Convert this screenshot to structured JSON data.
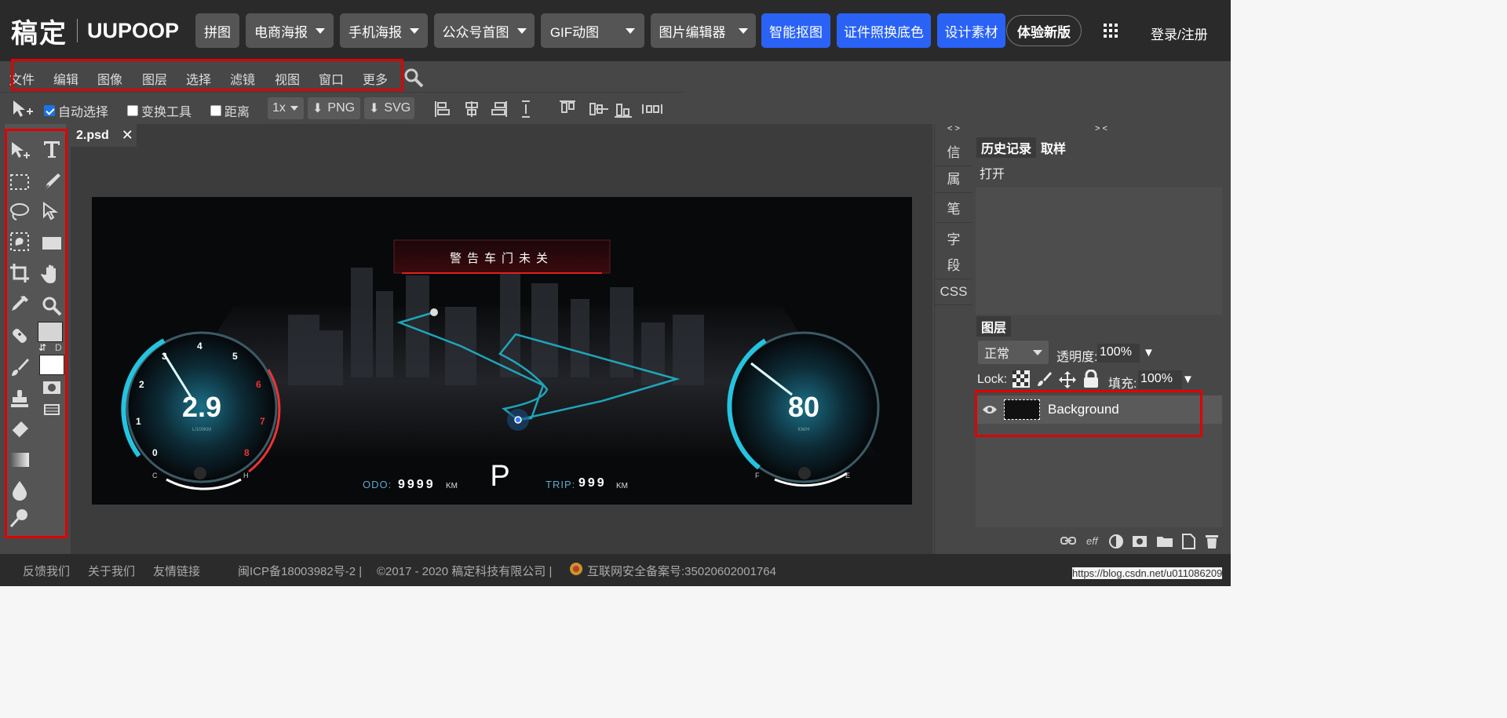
{
  "brand": {
    "cn": "稿定",
    "en": "UUPOOP"
  },
  "topnav": {
    "items": [
      "拼图",
      "电商海报",
      "手机海报",
      "公众号首图",
      "GIF动图",
      "图片编辑器"
    ],
    "blue_items": [
      "智能抠图",
      "证件照换底色",
      "设计素材"
    ],
    "new_version": "体验新版",
    "login": "登录/注册"
  },
  "menu": {
    "items": [
      "文件",
      "编辑",
      "图像",
      "图层",
      "选择",
      "滤镜",
      "视图",
      "窗口",
      "更多"
    ]
  },
  "options": {
    "auto_select": "自动选择",
    "auto_select_checked": true,
    "transform": "变换工具",
    "transform_checked": false,
    "distance": "距离",
    "distance_checked": false,
    "scale": "1x",
    "png": "PNG",
    "svg": "SVG"
  },
  "panel_toggle": {
    "left": "> <",
    "sidestrip": "< >",
    "right": "> <"
  },
  "document": {
    "tab": "2.psd"
  },
  "swatch_label": "D",
  "dashboard": {
    "warning": "警告车门未关",
    "fuel_value": "2.9",
    "fuel_unit": "L/100KM",
    "fuel_ticks": [
      "0",
      "1",
      "2",
      "3",
      "4",
      "5",
      "6",
      "7",
      "8"
    ],
    "fuel_cold": "C",
    "fuel_hot": "H",
    "speed_value": "80",
    "speed_unit": "KM/H",
    "speed_f": "F",
    "speed_e": "E",
    "odo_label": "ODO:",
    "odo_value": "9999",
    "odo_unit": "KM",
    "gear": "P",
    "trip_label": "TRIP:",
    "trip_value": "999",
    "trip_unit": "KM"
  },
  "sidestrip": {
    "items": [
      "信",
      "属",
      "笔",
      "字",
      "段",
      "CSS"
    ]
  },
  "history": {
    "tabs": [
      "历史记录",
      "取样"
    ],
    "entries": [
      "打开"
    ]
  },
  "layers": {
    "title": "图层",
    "blend_mode": "正常",
    "opacity_label": "透明度:",
    "opacity_value": "100%",
    "lock_label": "Lock:",
    "fill_label": "填充:",
    "fill_value": "100%",
    "items": [
      {
        "name": "Background"
      }
    ],
    "footer_eff": "eff"
  },
  "footer": {
    "links": [
      "反馈我们",
      "关于我们",
      "友情链接"
    ],
    "icp": "闽ICP备18003982号-2 |",
    "copyright": "©2017 - 2020 稿定科技有限公司 |",
    "police": "互联网安全备案号:35020602001764"
  },
  "watermark": "https://blog.csdn.net/u011086209",
  "colors": {
    "accent_blue": "#2962f5",
    "highlight_red": "#e00000",
    "gauge_cyan": "#22c8e6"
  }
}
